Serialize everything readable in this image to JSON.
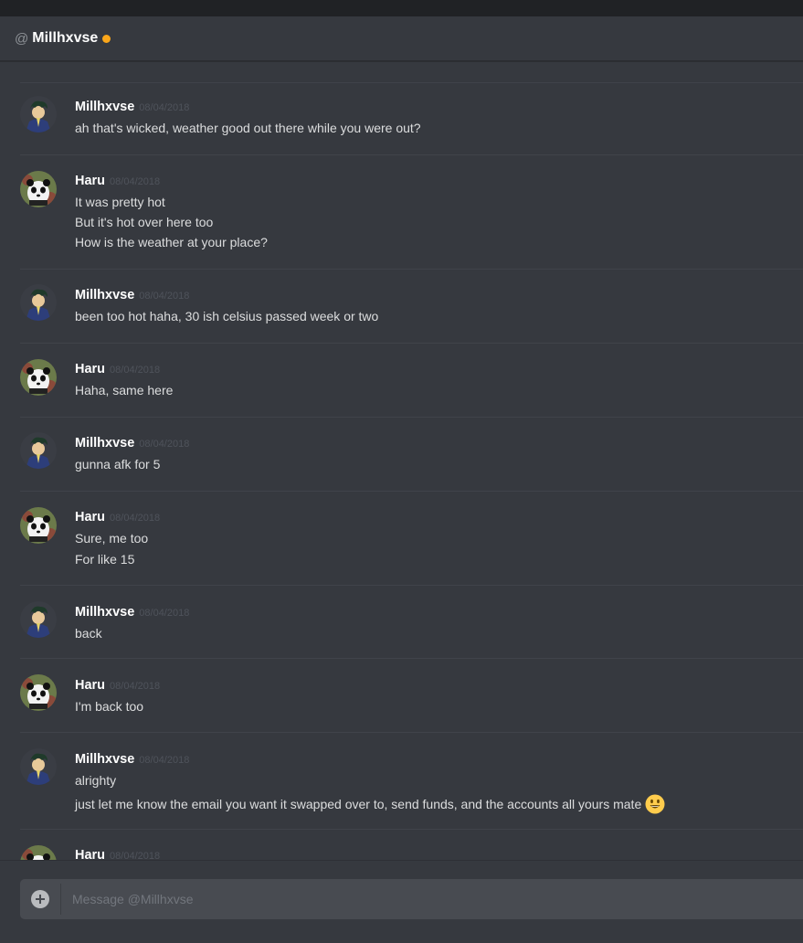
{
  "header": {
    "prefix": "@",
    "name": "Millhxvse",
    "status_color": "#faa61a"
  },
  "messages": [
    {
      "author": "Millhxvse",
      "avatar": "millhxvse-avatar",
      "timestamp": "08/04/2018",
      "lines": [
        "ah that's wicked, weather good out there while you were out?"
      ]
    },
    {
      "author": "Haru",
      "avatar": "haru-panda-avatar",
      "timestamp": "08/04/2018",
      "lines": [
        "It was pretty hot",
        "But it's hot over here too",
        "How is the weather at your place?"
      ]
    },
    {
      "author": "Millhxvse",
      "avatar": "millhxvse-avatar",
      "timestamp": "08/04/2018",
      "lines": [
        "been too hot haha, 30 ish celsius passed week or two"
      ]
    },
    {
      "author": "Haru",
      "avatar": "haru-panda-avatar",
      "timestamp": "08/04/2018",
      "lines": [
        "Haha, same here"
      ]
    },
    {
      "author": "Millhxvse",
      "avatar": "millhxvse-avatar",
      "timestamp": "08/04/2018",
      "lines": [
        "gunna afk for 5"
      ]
    },
    {
      "author": "Haru",
      "avatar": "haru-panda-avatar",
      "timestamp": "08/04/2018",
      "lines": [
        "Sure, me too",
        "For like 15"
      ]
    },
    {
      "author": "Millhxvse",
      "avatar": "millhxvse-avatar",
      "timestamp": "08/04/2018",
      "lines": [
        "back"
      ]
    },
    {
      "author": "Haru",
      "avatar": "haru-panda-avatar",
      "timestamp": "08/04/2018",
      "lines": [
        "I'm back too"
      ]
    },
    {
      "author": "Millhxvse",
      "avatar": "millhxvse-avatar",
      "timestamp": "08/04/2018",
      "lines": [
        "alrighty",
        "just let me know the email you want it swapped over to, send funds, and the accounts all yours mate"
      ],
      "emoji": "smiley-emoji"
    },
    {
      "author": "Haru",
      "avatar": "haru-panda-avatar",
      "timestamp": "08/04/2018",
      "lines": []
    }
  ],
  "composer": {
    "placeholder": "Message @Millhxvse",
    "value": ""
  }
}
